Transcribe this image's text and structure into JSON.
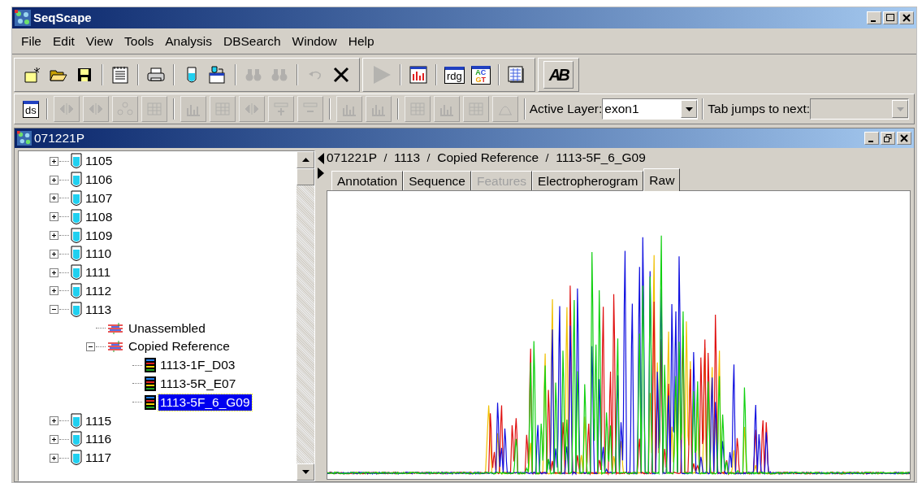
{
  "window": {
    "title": "SeqScape"
  },
  "menu": [
    "File",
    "Edit",
    "View",
    "Tools",
    "Analysis",
    "DBSearch",
    "Window",
    "Help"
  ],
  "toolbar1": [
    {
      "kind": "new",
      "disabled": false
    },
    {
      "kind": "open",
      "disabled": false
    },
    {
      "kind": "save",
      "disabled": false
    },
    {
      "kind": "sep"
    },
    {
      "kind": "notes",
      "disabled": false
    },
    {
      "kind": "sep"
    },
    {
      "kind": "print",
      "disabled": false
    },
    {
      "kind": "sep"
    },
    {
      "kind": "tube",
      "disabled": false
    },
    {
      "kind": "import",
      "disabled": false
    },
    {
      "kind": "sep"
    },
    {
      "kind": "find",
      "disabled": true
    },
    {
      "kind": "find",
      "disabled": true
    },
    {
      "kind": "sep"
    },
    {
      "kind": "undo",
      "disabled": true
    },
    {
      "kind": "delete",
      "disabled": false
    },
    {
      "kind": "break"
    },
    {
      "kind": "play",
      "disabled": true
    },
    {
      "kind": "sep"
    },
    {
      "kind": "report",
      "disabled": false
    },
    {
      "kind": "sep"
    },
    {
      "kind": "labeled",
      "label": "rdg",
      "disabled": false
    },
    {
      "kind": "acgt",
      "lines": [
        "AC",
        "GT"
      ],
      "disabled": false
    },
    {
      "kind": "sep"
    },
    {
      "kind": "table",
      "disabled": false
    },
    {
      "kind": "break"
    },
    {
      "kind": "logo",
      "label": "AB",
      "disabled": false
    }
  ],
  "toolbar2": [
    {
      "kind": "labeled",
      "label": "ds",
      "disabled": false
    },
    {
      "kind": "sep"
    },
    {
      "kind": "arrows",
      "disabled": true
    },
    {
      "kind": "arrows",
      "disabled": true
    },
    {
      "kind": "nodes",
      "disabled": true
    },
    {
      "kind": "grid",
      "disabled": true
    },
    {
      "kind": "sep"
    },
    {
      "kind": "bars",
      "disabled": true
    },
    {
      "kind": "grid",
      "disabled": true
    },
    {
      "kind": "arrows",
      "disabled": true
    },
    {
      "kind": "plus",
      "disabled": true
    },
    {
      "kind": "minus",
      "disabled": true
    },
    {
      "kind": "sep"
    },
    {
      "kind": "bars",
      "disabled": true
    },
    {
      "kind": "bars",
      "disabled": true
    },
    {
      "kind": "sep"
    },
    {
      "kind": "grid",
      "disabled": true
    },
    {
      "kind": "bars",
      "disabled": true
    },
    {
      "kind": "grid",
      "disabled": true
    },
    {
      "kind": "peak",
      "disabled": true
    }
  ],
  "active_layer": {
    "label": "Active Layer:",
    "value": "exon1"
  },
  "tab_jumps": {
    "label": "Tab jumps to next:"
  },
  "project_window": {
    "title": "071221P"
  },
  "tree": [
    {
      "label": "1105",
      "kind": "sample",
      "expanded": false
    },
    {
      "label": "1106",
      "kind": "sample",
      "expanded": false
    },
    {
      "label": "1107",
      "kind": "sample",
      "expanded": false
    },
    {
      "label": "1108",
      "kind": "sample",
      "expanded": false
    },
    {
      "label": "1109",
      "kind": "sample",
      "expanded": false
    },
    {
      "label": "1110",
      "kind": "sample",
      "expanded": false
    },
    {
      "label": "1111",
      "kind": "sample",
      "expanded": false
    },
    {
      "label": "1112",
      "kind": "sample",
      "expanded": false
    },
    {
      "label": "1113",
      "kind": "sample",
      "expanded": true,
      "children": [
        {
          "label": "Unassembled",
          "kind": "group",
          "selected": false
        },
        {
          "label": "Copied Reference",
          "kind": "group",
          "expanded": true,
          "children": [
            {
              "label": "1113-1F_D03",
              "kind": "trace",
              "selected": false
            },
            {
              "label": "1113-5R_E07",
              "kind": "trace",
              "selected": false
            },
            {
              "label": "1113-5F_6_G09",
              "kind": "trace",
              "selected": true
            }
          ]
        }
      ]
    },
    {
      "label": "1115",
      "kind": "sample",
      "expanded": false
    },
    {
      "label": "1116",
      "kind": "sample",
      "expanded": false
    },
    {
      "label": "1117",
      "kind": "sample",
      "expanded": false
    }
  ],
  "breadcrumb": [
    "071221P",
    "1113",
    "Copied Reference",
    "1113-5F_6_G09"
  ],
  "tabs": [
    {
      "label": "Annotation",
      "selected": false,
      "disabled": false
    },
    {
      "label": "Sequence",
      "selected": false,
      "disabled": false
    },
    {
      "label": "Features",
      "selected": false,
      "disabled": true
    },
    {
      "label": "Electropherogram",
      "selected": false,
      "disabled": false
    },
    {
      "label": "Raw",
      "selected": true,
      "disabled": false
    }
  ]
}
